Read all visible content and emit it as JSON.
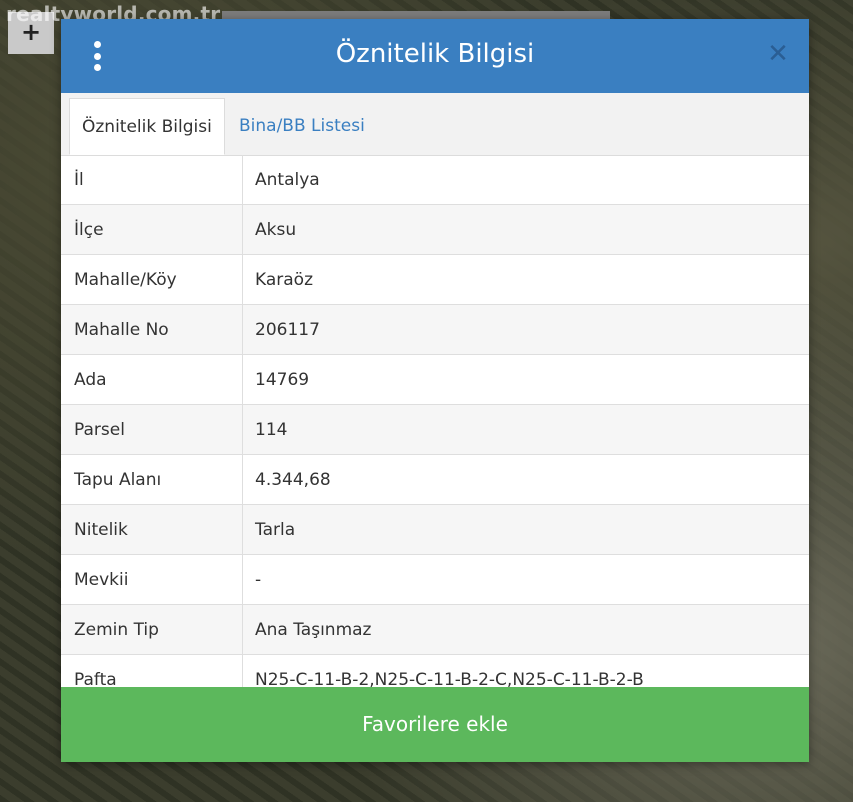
{
  "watermark": "realtyworld.com.tr",
  "map": {
    "zoom_in_label": "+"
  },
  "modal": {
    "title": "Öznitelik Bilgisi",
    "close_label": "✕",
    "tabs": [
      {
        "label": "Öznitelik Bilgisi",
        "active": true
      },
      {
        "label": "Bina/BB Listesi",
        "active": false
      }
    ],
    "rows": [
      {
        "key": "İl",
        "value": "Antalya"
      },
      {
        "key": "İlçe",
        "value": "Aksu"
      },
      {
        "key": "Mahalle/Köy",
        "value": "Karaöz"
      },
      {
        "key": "Mahalle No",
        "value": "206117"
      },
      {
        "key": "Ada",
        "value": "14769"
      },
      {
        "key": "Parsel",
        "value": "114"
      },
      {
        "key": "Tapu Alanı",
        "value": "4.344,68"
      },
      {
        "key": "Nitelik",
        "value": "Tarla"
      },
      {
        "key": "Mevkii",
        "value": "-"
      },
      {
        "key": "Zemin Tip",
        "value": "Ana Taşınmaz"
      },
      {
        "key": "Pafta",
        "value": "N25-C-11-B-2,N25-C-11-B-2-C,N25-C-11-B-2-B"
      }
    ],
    "favorite_button": "Favorilere ekle"
  },
  "colors": {
    "header": "#3a7fc1",
    "favorite": "#5cb85c",
    "close_icon": "#2a5e94"
  }
}
